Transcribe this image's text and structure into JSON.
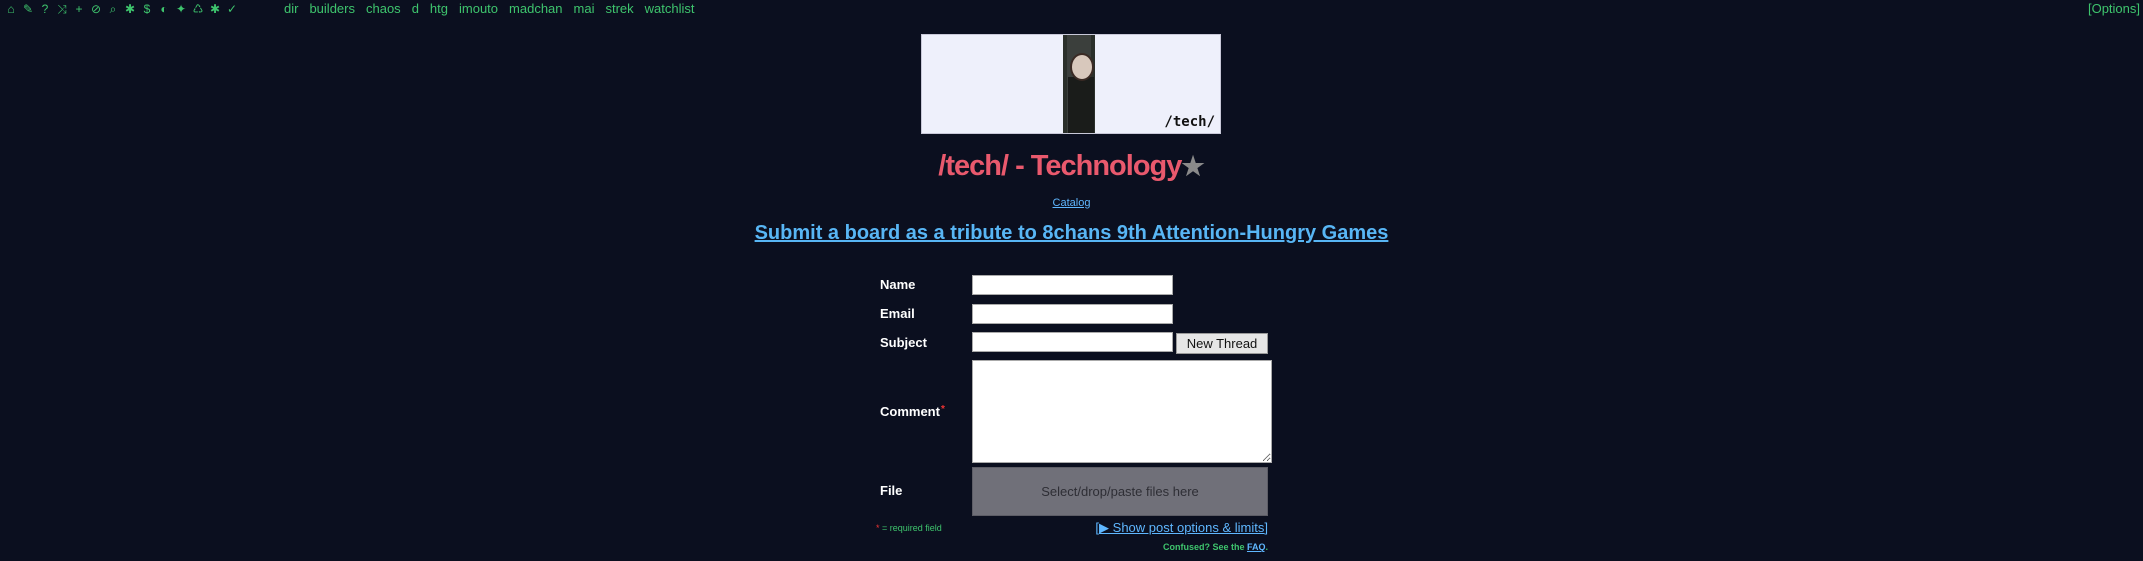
{
  "topbar": {
    "icons": [
      "home-icon",
      "tags-icon",
      "help-icon",
      "shuffle-icon",
      "plus-icon",
      "ban-icon",
      "search-icon",
      "gear-icon",
      "dollar-icon",
      "contrast-icon",
      "twitter-icon",
      "recycle-icon",
      "bug-icon",
      "check-circle-icon"
    ],
    "icon_glyphs": [
      "⌂",
      "✎",
      "?",
      "⤨",
      "+",
      "⊘",
      "⌕",
      "✱",
      "$",
      "◐",
      "✦",
      "♺",
      "✱",
      "✓"
    ],
    "boards": [
      "dir",
      "builders",
      "chaos",
      "d",
      "htg",
      "imouto",
      "madchan",
      "mai",
      "strek",
      "watchlist"
    ],
    "options_label": "[Options]"
  },
  "banner": {
    "label": "/tech/"
  },
  "board": {
    "title": "/tech/ - Technology",
    "star": "★"
  },
  "catalog_link": "Catalog",
  "announcement": "Submit a board as a tribute to 8chans 9th Attention-Hungry Games",
  "form": {
    "name_label": "Name",
    "email_label": "Email",
    "subject_label": "Subject",
    "comment_label": "Comment",
    "comment_required": "*",
    "file_label": "File",
    "submit_label": "New Thread",
    "name_value": "",
    "email_value": "",
    "subject_value": "",
    "dropzone_text": "Select/drop/paste files here",
    "required_asterisk": "*",
    "required_text": " = required field",
    "post_options_link": "[▶ Show post options & limits]",
    "faq_prefix": "Confused? See the ",
    "faq_link": "FAQ",
    "faq_suffix": "."
  },
  "colors": {
    "background": "#0b0f1f",
    "accent_green": "#3ec46d",
    "title_red": "#e9596d",
    "link_blue": "#5fb7ff"
  }
}
